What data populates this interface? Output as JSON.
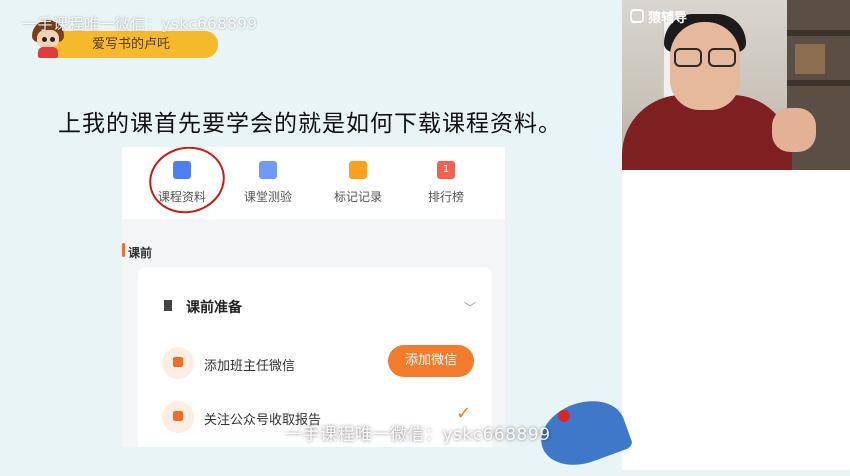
{
  "watermark": {
    "top": "一手课程唯一微信：yskc668899",
    "bottom": "一手课程唯一微信：yskc668899"
  },
  "teacher_tag": {
    "name": "爱写书的卢吒"
  },
  "webcam": {
    "logo_text": "猿辅导"
  },
  "slide": {
    "heading": "上我的课首先要学会的就是如何下载课程资料。"
  },
  "phone": {
    "tabs": [
      {
        "label": "课程资料",
        "icon": "folder-icon",
        "color": "#4e7ff2"
      },
      {
        "label": "课堂测验",
        "icon": "edit-icon",
        "color": "#6e9bf5"
      },
      {
        "label": "标记记录",
        "icon": "note-icon",
        "color": "#ff9f1c"
      },
      {
        "label": "排行榜",
        "icon": "rank-icon",
        "color": "#f2604f",
        "badge": "1"
      }
    ],
    "section_title": "课前",
    "card": {
      "title": "课前准备",
      "rows": [
        {
          "label": "添加班主任微信",
          "button": "添加微信"
        },
        {
          "label": "关注公众号收取报告",
          "status": "✓"
        }
      ]
    },
    "accent_color": "#f37b2c"
  }
}
